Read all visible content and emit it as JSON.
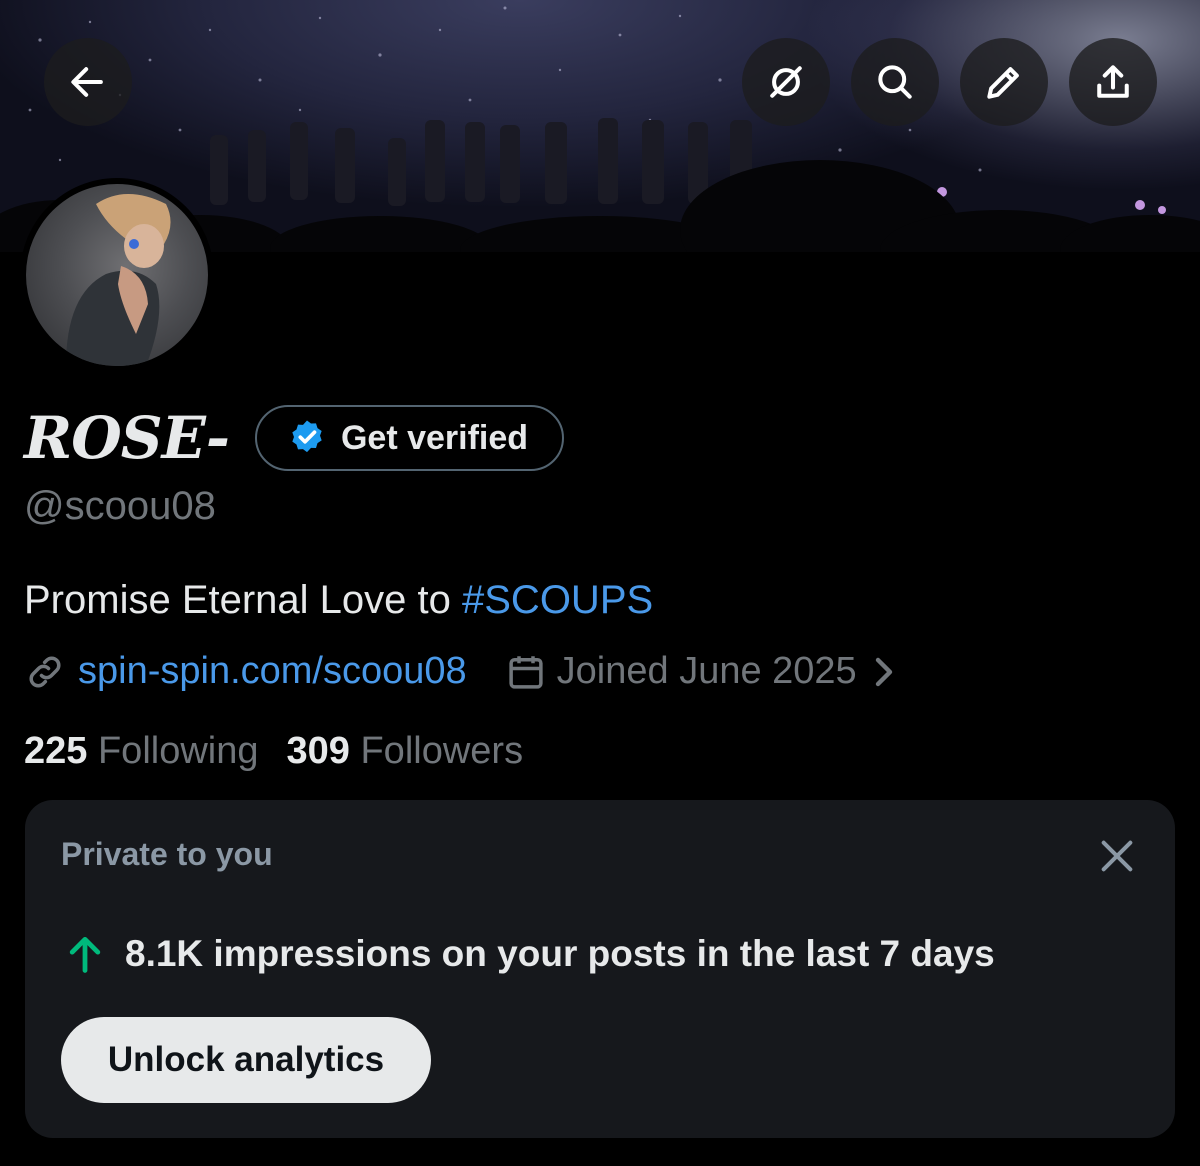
{
  "header": {
    "back_icon": "arrow-left-icon",
    "actions": [
      "grok-icon",
      "search-icon",
      "edit-icon",
      "share-icon"
    ]
  },
  "profile": {
    "display_name": "ROSE-",
    "get_verified_label": "Get verified",
    "handle": "@scoou08",
    "bio_text": "Promise Eternal Love to ",
    "bio_hashtag": "#SCOUPS",
    "website": "spin-spin.com/scoou08",
    "joined": "Joined June 2025",
    "following_count": "225",
    "following_label": "Following",
    "followers_count": "309",
    "followers_label": "Followers"
  },
  "analytics_card": {
    "title": "Private to you",
    "impressions_text": "8.1K impressions on your posts in the last 7 days",
    "unlock_label": "Unlock analytics"
  },
  "colors": {
    "background": "#000000",
    "accent_link": "#4a99e9",
    "muted_text": "#71767b",
    "card_bg": "#16181c",
    "up_arrow": "#00ba7c"
  }
}
